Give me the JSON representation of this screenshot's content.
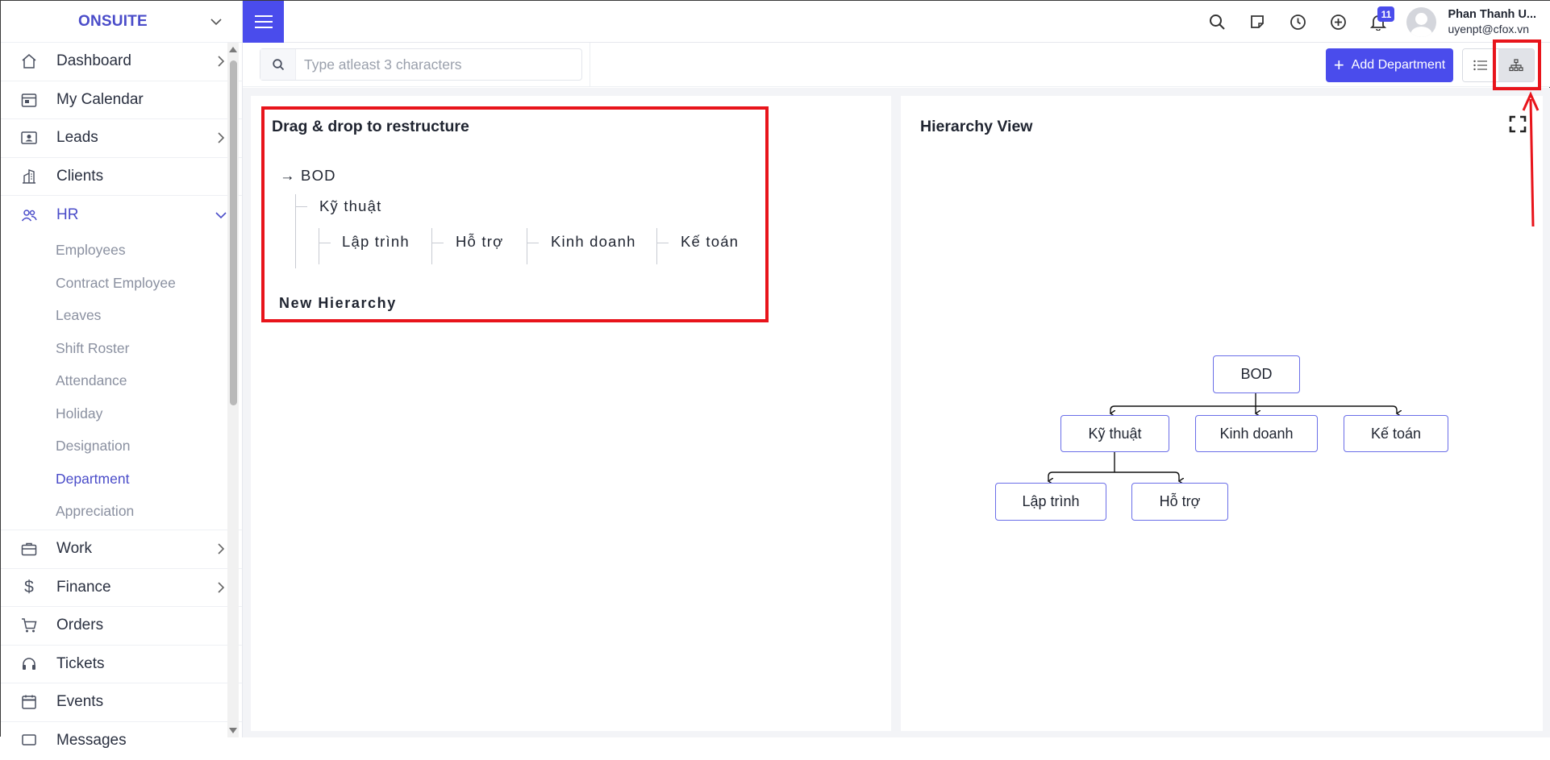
{
  "brand": {
    "name": "ONSUITE"
  },
  "sidebar": {
    "items": [
      {
        "label": "Dashboard",
        "icon": "home-icon",
        "has_arrow": true
      },
      {
        "label": "My Calendar",
        "icon": "calendar-icon",
        "has_arrow": false
      },
      {
        "label": "Leads",
        "icon": "contact-card-icon",
        "has_arrow": true
      },
      {
        "label": "Clients",
        "icon": "building-icon",
        "has_arrow": false
      },
      {
        "label": "HR",
        "icon": "users-icon",
        "has_arrow": true,
        "expanded": true
      }
    ],
    "hr_sub": [
      "Employees",
      "Contract Employee",
      "Leaves",
      "Shift Roster",
      "Attendance",
      "Holiday",
      "Designation",
      "Department",
      "Appreciation"
    ],
    "hr_sub_current": "Department",
    "items_after": [
      {
        "label": "Work",
        "icon": "briefcase-icon",
        "has_arrow": true
      },
      {
        "label": "Finance",
        "icon": "dollar-icon",
        "has_arrow": true
      },
      {
        "label": "Orders",
        "icon": "cart-icon",
        "has_arrow": false
      },
      {
        "label": "Tickets",
        "icon": "headset-icon",
        "has_arrow": false
      },
      {
        "label": "Events",
        "icon": "event-calendar-icon",
        "has_arrow": false
      },
      {
        "label": "Messages",
        "icon": "message-icon",
        "has_arrow": false
      }
    ]
  },
  "header": {
    "notification_count": "11",
    "user_name": "Phan Thanh U...",
    "user_email": "uyenpt@cfox.vn"
  },
  "toolbar": {
    "search_placeholder": "Type atleast 3 characters",
    "add_label": "Add Department"
  },
  "left_panel": {
    "title": "Drag & drop to restructure",
    "root": "BOD",
    "root_prefix": "→",
    "level1": "Kỹ thuật",
    "level2": [
      "Lập trình",
      "Hỗ trợ",
      "Kinh doanh",
      "Kế toán"
    ],
    "new_hierarchy": "New Hierarchy"
  },
  "right_panel": {
    "title": "Hierarchy View",
    "org": {
      "root": "BOD",
      "children": [
        "Kỹ thuật",
        "Kinh doanh",
        "Kế toán"
      ],
      "grandchildren": [
        "Lập trình",
        "Hỗ trợ"
      ]
    }
  },
  "colors": {
    "accent": "#4a4cec",
    "annotation": "#e8141b",
    "sidebar_active": "#4a4cc9"
  }
}
